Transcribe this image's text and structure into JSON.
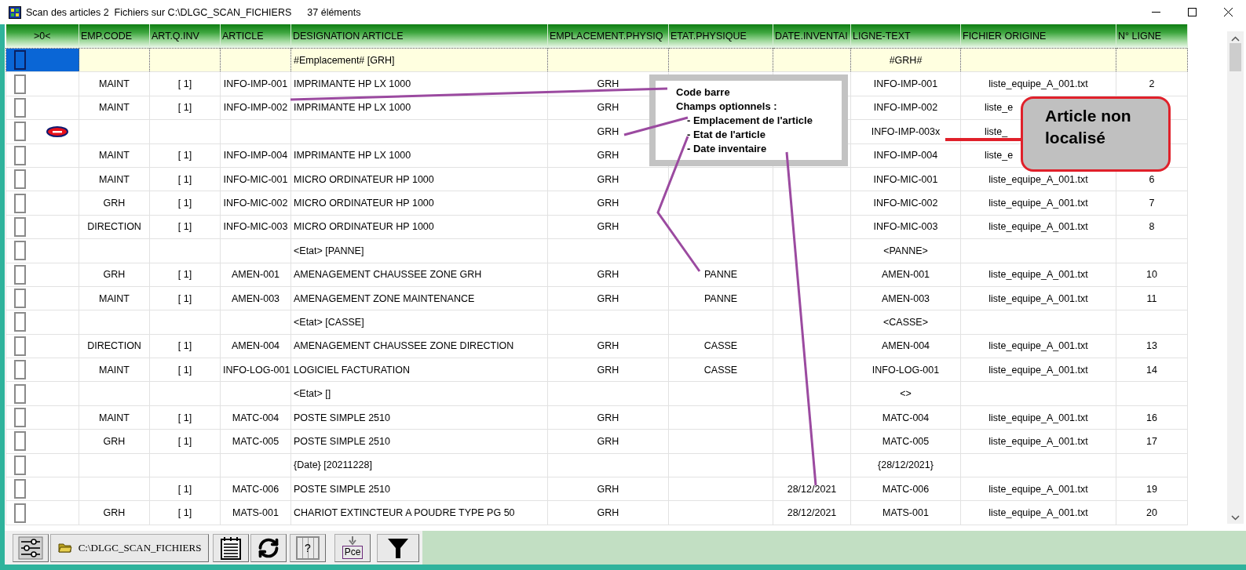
{
  "window": {
    "title": "Scan des articles 2  Fichiers sur C:\\DLGC_SCAN_FICHIERS",
    "count": "37 éléments"
  },
  "columns": [
    ">0<",
    "EMP.CODE",
    "ART.Q.INV",
    "ARTICLE",
    "DESIGNATION ARTICLE",
    "EMPLACEMENT.PHYSIQ",
    "ETAT.PHYSIQUE",
    "DATE.INVENTAI",
    "LIGNE-TEXT",
    "FICHIER ORIGINE",
    "N° LIGNE"
  ],
  "filter_row": {
    "selected": true,
    "checked": false,
    "designation": "#Emplacement# [GRH]",
    "ligne_text": "#GRH#"
  },
  "rows": [
    {
      "kind": "item",
      "selected": false,
      "checked": false,
      "emp_code": "MAINT",
      "art_q_inv": "[ 1]",
      "article": "INFO-IMP-001",
      "designation": "IMPRIMANTE HP LX 1000",
      "emplacement": "GRH",
      "ligne_text": "INFO-IMP-001",
      "fichier": "liste_equipe_A_001.txt",
      "n_ligne": "2"
    },
    {
      "kind": "item",
      "selected": false,
      "checked": false,
      "emp_code": "MAINT",
      "art_q_inv": "[ 1]",
      "article": "INFO-IMP-002",
      "designation": "IMPRIMANTE HP LX 1000",
      "emplacement": "GRH",
      "ligne_text": "INFO-IMP-002",
      "fichier": "liste_e",
      "fichier_cut": true
    },
    {
      "kind": "error",
      "selected": false,
      "checked": false,
      "emplacement": "GRH",
      "ligne_text": "INFO-IMP-003x",
      "fichier": "liste_",
      "fichier_cut": true
    },
    {
      "kind": "item",
      "selected": false,
      "checked": false,
      "emp_code": "MAINT",
      "art_q_inv": "[ 1]",
      "article": "INFO-IMP-004",
      "designation": "IMPRIMANTE HP LX 1000",
      "emplacement": "GRH",
      "ligne_text": "INFO-IMP-004",
      "fichier": "liste_e",
      "fichier_cut": true
    },
    {
      "kind": "item",
      "selected": false,
      "checked": false,
      "emp_code": "MAINT",
      "art_q_inv": "[ 1]",
      "article": "INFO-MIC-001",
      "designation": "MICRO ORDINATEUR HP 1000",
      "emplacement": "GRH",
      "ligne_text": "INFO-MIC-001",
      "fichier": "liste_equipe_A_001.txt",
      "n_ligne": "6"
    },
    {
      "kind": "item",
      "selected": false,
      "checked": false,
      "emp_code": "GRH",
      "art_q_inv": "[ 1]",
      "article": "INFO-MIC-002",
      "designation": "MICRO ORDINATEUR HP 1000",
      "emplacement": "GRH",
      "ligne_text": "INFO-MIC-002",
      "fichier": "liste_equipe_A_001.txt",
      "n_ligne": "7"
    },
    {
      "kind": "item",
      "selected": false,
      "checked": false,
      "emp_code": "DIRECTION",
      "art_q_inv": "[ 1]",
      "article": "INFO-MIC-003",
      "designation": "MICRO ORDINATEUR HP 1000",
      "emplacement": "GRH",
      "ligne_text": "INFO-MIC-003",
      "fichier": "liste_equipe_A_001.txt",
      "n_ligne": "8"
    },
    {
      "kind": "marker",
      "selected": false,
      "checked": false,
      "designation": "<Etat> [PANNE]",
      "ligne_text": "<PANNE>"
    },
    {
      "kind": "item",
      "selected": false,
      "checked": false,
      "emp_code": "GRH",
      "art_q_inv": "[ 1]",
      "article": "AMEN-001",
      "designation": "AMENAGEMENT CHAUSSEE ZONE GRH",
      "emplacement": "GRH",
      "etat": "PANNE",
      "ligne_text": "AMEN-001",
      "fichier": "liste_equipe_A_001.txt",
      "n_ligne": "10"
    },
    {
      "kind": "item",
      "selected": false,
      "checked": false,
      "emp_code": "MAINT",
      "art_q_inv": "[ 1]",
      "article": "AMEN-003",
      "designation": "AMENAGEMENT ZONE MAINTENANCE",
      "emplacement": "GRH",
      "etat": "PANNE",
      "ligne_text": "AMEN-003",
      "fichier": "liste_equipe_A_001.txt",
      "n_ligne": "11"
    },
    {
      "kind": "marker",
      "selected": false,
      "checked": false,
      "designation": "<Etat> [CASSE]",
      "ligne_text": "<CASSE>"
    },
    {
      "kind": "item",
      "selected": false,
      "checked": false,
      "emp_code": "DIRECTION",
      "art_q_inv": "[ 1]",
      "article": "AMEN-004",
      "designation": "AMENAGEMENT CHAUSSEE ZONE DIRECTION",
      "emplacement": "GRH",
      "etat": "CASSE",
      "ligne_text": "AMEN-004",
      "fichier": "liste_equipe_A_001.txt",
      "n_ligne": "13"
    },
    {
      "kind": "item",
      "selected": false,
      "checked": false,
      "emp_code": "MAINT",
      "art_q_inv": "[ 1]",
      "article": "INFO-LOG-001",
      "designation": "LOGICIEL FACTURATION",
      "emplacement": "GRH",
      "etat": "CASSE",
      "ligne_text": "INFO-LOG-001",
      "fichier": "liste_equipe_A_001.txt",
      "n_ligne": "14"
    },
    {
      "kind": "marker",
      "selected": false,
      "checked": false,
      "designation": "<Etat> []",
      "ligne_text": "<>"
    },
    {
      "kind": "item",
      "selected": false,
      "checked": false,
      "emp_code": "MAINT",
      "art_q_inv": "[ 1]",
      "article": "MATC-004",
      "designation": "POSTE SIMPLE 2510",
      "emplacement": "GRH",
      "ligne_text": "MATC-004",
      "fichier": "liste_equipe_A_001.txt",
      "n_ligne": "16"
    },
    {
      "kind": "item",
      "selected": false,
      "checked": false,
      "emp_code": "GRH",
      "art_q_inv": "[ 1]",
      "article": "MATC-005",
      "designation": "POSTE SIMPLE 2510",
      "emplacement": "GRH",
      "ligne_text": "MATC-005",
      "fichier": "liste_equipe_A_001.txt",
      "n_ligne": "17"
    },
    {
      "kind": "marker",
      "selected": false,
      "checked": false,
      "designation": "{Date} [20211228]",
      "ligne_text": "{28/12/2021}"
    },
    {
      "kind": "item",
      "selected": false,
      "checked": false,
      "art_q_inv": "[ 1]",
      "article": "MATC-006",
      "designation": "POSTE SIMPLE 2510",
      "emplacement": "GRH",
      "date": "28/12/2021",
      "ligne_text": "MATC-006",
      "fichier": "liste_equipe_A_001.txt",
      "n_ligne": "19"
    },
    {
      "kind": "item",
      "selected": false,
      "checked": false,
      "emp_code": "GRH",
      "art_q_inv": "[ 1]",
      "article": "MATS-001",
      "designation": "CHARIOT EXTINCTEUR A POUDRE TYPE PG 50",
      "emplacement": "GRH",
      "date": "28/12/2021",
      "ligne_text": "MATS-001",
      "fichier": "liste_equipe_A_001.txt",
      "n_ligne": "20"
    }
  ],
  "callout": {
    "lines": [
      {
        "kind": "heading",
        "text": "Code barre"
      },
      {
        "kind": "heading",
        "text": "Champs optionnels :"
      },
      {
        "kind": "item",
        "text": "- Emplacement de l'article"
      },
      {
        "kind": "item",
        "text": "- Etat de l'article"
      },
      {
        "kind": "item",
        "text": "- Date inventaire"
      }
    ]
  },
  "note": {
    "text": "Article non localisé"
  },
  "toolbar": [
    {
      "kind": "settings"
    },
    {
      "kind": "folder",
      "label": "C:\\DLGC_SCAN_FICHIERS"
    },
    {
      "kind": "notes"
    },
    {
      "kind": "refresh"
    },
    {
      "kind": "help-grid",
      "label": "?"
    },
    {
      "kind": "import",
      "label": "Pce"
    },
    {
      "kind": "filter"
    }
  ]
}
